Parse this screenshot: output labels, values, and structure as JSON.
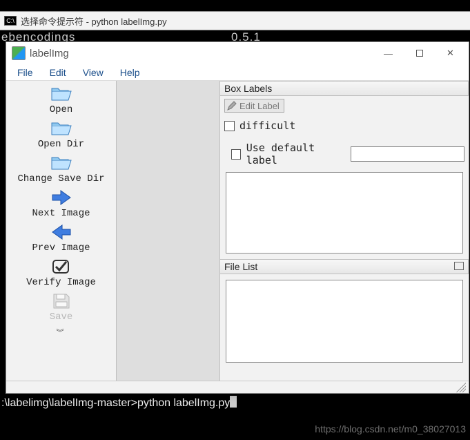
{
  "bg_terminal": {
    "title": "选择命令提示符 - python  labelImg.py",
    "top_line_left": "ebencodings",
    "top_line_version": "0.5.1",
    "bottom_prompt": ":\\labelimg\\labelImg-master>python labelImg.py"
  },
  "window": {
    "title": "labelImg",
    "menu": [
      "File",
      "Edit",
      "View",
      "Help"
    ]
  },
  "toolbar": [
    {
      "id": "open",
      "label": "Open",
      "icon": "folder-open-icon"
    },
    {
      "id": "open-dir",
      "label": "Open Dir",
      "icon": "folder-open-icon"
    },
    {
      "id": "change-save-dir",
      "label": "Change Save Dir",
      "icon": "folder-open-icon"
    },
    {
      "id": "next-image",
      "label": "Next Image",
      "icon": "arrow-right-icon"
    },
    {
      "id": "prev-image",
      "label": "Prev Image",
      "icon": "arrow-left-icon"
    },
    {
      "id": "verify-image",
      "label": "Verify Image",
      "icon": "checkmark-icon"
    },
    {
      "id": "save",
      "label": "Save",
      "icon": "floppy-icon"
    }
  ],
  "panels": {
    "box_labels": {
      "title": "Box Labels",
      "edit_btn": "Edit Label",
      "difficult_label": "difficult",
      "use_default_label": "Use default label",
      "default_value": ""
    },
    "file_list": {
      "title": "File List"
    }
  },
  "watermark": "https://blog.csdn.net/m0_38027013"
}
